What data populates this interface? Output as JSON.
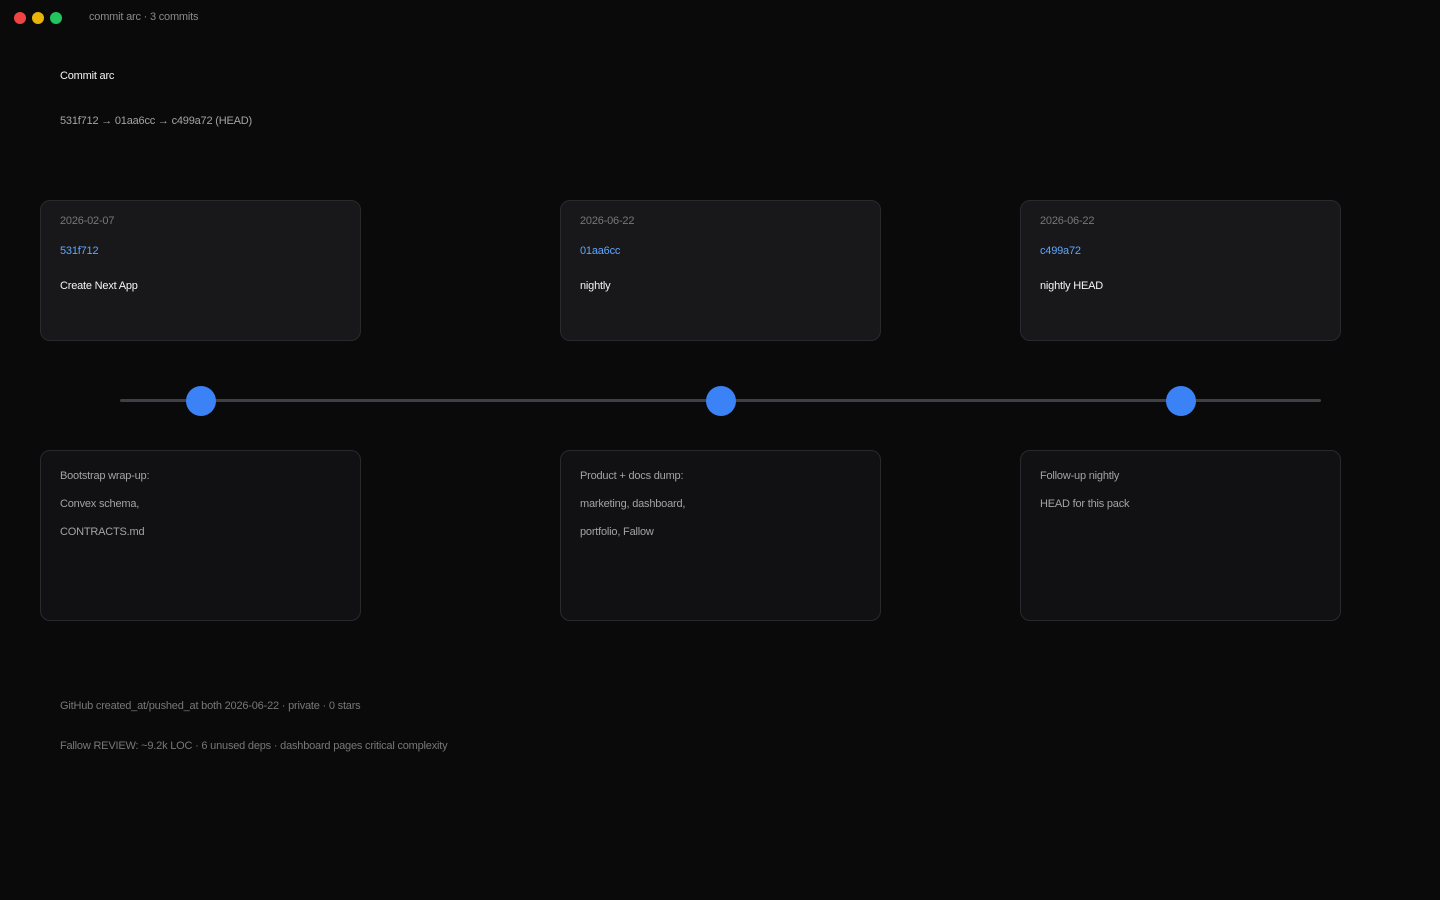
{
  "window": {
    "title": "commit arc · 3 commits",
    "colors": {
      "close": "#ef4444",
      "minimize": "#eab308",
      "maximize": "#22c55e"
    }
  },
  "header": {
    "title": "Commit arc",
    "subtitle": "531f712 → 01aa6cc → c499a72 (HEAD)"
  },
  "commits": [
    {
      "date": "2026-02-07",
      "sha": "531f712",
      "message": "Create Next App",
      "description": [
        "Bootstrap wrap-up:",
        "Convex schema,",
        "CONTRACTS.md"
      ]
    },
    {
      "date": "2026-06-22",
      "sha": "01aa6cc",
      "message": "nightly",
      "description": [
        "Product + docs dump:",
        "marketing, dashboard,",
        "portfolio, Fallow"
      ]
    },
    {
      "date": "2026-06-22",
      "sha": "c499a72",
      "message": "nightly HEAD",
      "description": [
        "Follow-up nightly",
        "HEAD for this pack"
      ]
    }
  ],
  "footer": {
    "line1": "GitHub created_at/pushed_at both 2026-06-22 · private · 0 stars",
    "line2": "Fallow REVIEW: ~9.2k LOC · 6 unused deps · dashboard pages critical complexity"
  },
  "colors": {
    "accent": "#3b82f6",
    "sha": "#60a5fa",
    "background": "#0a0a0a"
  }
}
